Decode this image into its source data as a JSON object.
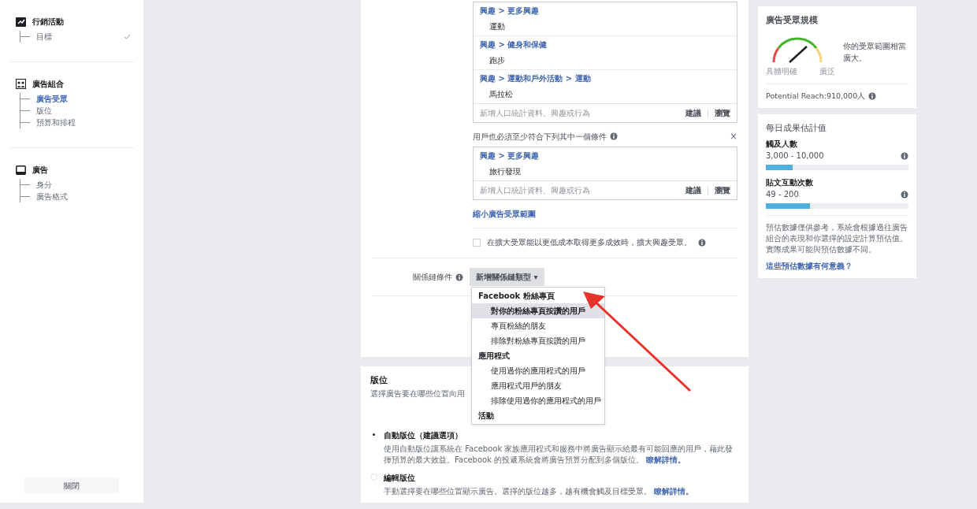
{
  "sidebar": {
    "sections": [
      {
        "title": "行銷活動",
        "items": [
          {
            "label": "目標",
            "selected": false,
            "done": true
          }
        ]
      },
      {
        "title": "廣告組合",
        "items": [
          {
            "label": "廣告受眾",
            "selected": true,
            "done": false
          },
          {
            "label": "版位",
            "selected": false,
            "done": false
          },
          {
            "label": "預算和排程",
            "selected": false,
            "done": false
          }
        ]
      },
      {
        "title": "廣告",
        "items": [
          {
            "label": "身分",
            "selected": false,
            "done": false
          },
          {
            "label": "廣告格式",
            "selected": false,
            "done": false
          }
        ]
      }
    ],
    "close_button": "關閉"
  },
  "targeting": {
    "include_box": {
      "entries": [
        {
          "path": "興趣 > 更多興趣",
          "item": "運動"
        },
        {
          "path": "興趣 > 健身和保健",
          "item": "跑步"
        },
        {
          "path": "興趣 > 運動和戶外活動 > 運動",
          "item": "馬拉松"
        }
      ],
      "placeholder": "新增人口統計資料、興趣或行為",
      "suggest": "建議",
      "browse": "瀏覽"
    },
    "narrow_label": "用戶也必須至少符合下列其中一個條件",
    "close": "×",
    "narrow_box": {
      "entries": [
        {
          "path": "興趣 > 更多興趣",
          "item": "旅行發現"
        }
      ],
      "placeholder": "新增人口統計資料、興趣或行為",
      "suggest": "建議",
      "browse": "瀏覽"
    },
    "narrow_more_link": "縮小廣告受眾範圍",
    "expand": {
      "label": "在擴大受眾能以更低成本取得更多成效時，擴大興趣受眾。",
      "checked": false
    }
  },
  "connections": {
    "label": "關係鏈條件",
    "dropdown": "新增關係鏈類型 ▾",
    "menu": [
      {
        "kind": "header",
        "label": "Facebook 粉絲專頁"
      },
      {
        "kind": "option",
        "label": "對你的粉絲專頁按讚的用戶",
        "selected": true
      },
      {
        "kind": "option",
        "label": "專頁粉絲的朋友",
        "selected": false
      },
      {
        "kind": "option",
        "label": "排除對粉絲專頁按讚的用戶",
        "selected": false
      },
      {
        "kind": "header",
        "label": "應用程式"
      },
      {
        "kind": "option",
        "label": "使用過你的應用程式的用戶",
        "selected": false
      },
      {
        "kind": "option",
        "label": "應用程式用戶的朋友",
        "selected": false
      },
      {
        "kind": "option",
        "label": "排除使用過你的應用程式的用戶",
        "selected": false
      },
      {
        "kind": "header",
        "label": "活動"
      }
    ]
  },
  "placements": {
    "title": "版位",
    "subtitle": "選擇廣告要在哪些位置向用",
    "options": [
      {
        "label": "自動版位（建議選項）",
        "selected": true,
        "desc": "使用自動版位讓系統在 Facebook 家族應用程式和服務中將廣告顯示給最有可能回應的用戶，藉此發揮預算的最大效益。Facebook 的投遞系統會將廣告預算分配到多個版位。",
        "link": "瞭解詳情。"
      },
      {
        "label": "編輯版位",
        "selected": false,
        "desc": "手動選擇要在哪些位置顯示廣告。選擇的版位越多，越有機會觸及目標受眾。",
        "link": "瞭解詳情。"
      }
    ]
  },
  "audience_size": {
    "title": "廣告受眾規模",
    "note": "你的受眾範圍相當廣大。",
    "left": "具體明確",
    "right": "廣泛",
    "reach": "Potential Reach:910,000人"
  },
  "estimates": {
    "title": "每日成果估計值",
    "metrics": [
      {
        "label": "觸及人數",
        "range": "3,000 - 10,000",
        "level": 0.19
      },
      {
        "label": "貼文互動次數",
        "range": "49 - 200",
        "level": 0.31
      }
    ],
    "note": "預估數據僅供參考，系統會根據過往廣告組合的表現和你選擇的設定計算預估值。實際成果可能與預估數據不同。",
    "link": "這些預估數據有何意義？"
  }
}
